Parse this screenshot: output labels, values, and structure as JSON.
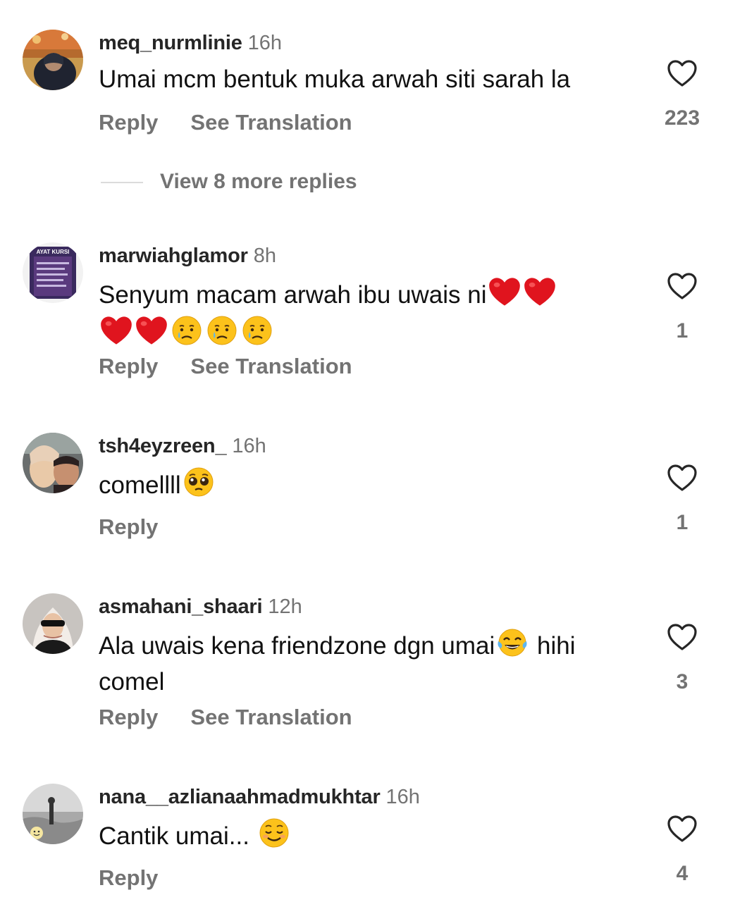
{
  "colors": {
    "text": "#111111",
    "secondary": "#737373",
    "divider": "#dbdbdb",
    "heart_red": "#e0141e"
  },
  "icons": {
    "like": "heart-outline-icon",
    "red_heart": "red-heart-emoji",
    "crying": "crying-face-emoji",
    "pleading": "pleading-face-emoji",
    "tears_of_joy": "tears-of-joy-emoji",
    "smiling": "smiling-face-emoji"
  },
  "comments": [
    {
      "username": "meq_nurmlinie",
      "time": "16h",
      "text": "Umai mcm bentuk muka arwah siti sarah la",
      "reply": "Reply",
      "translate": "See Translation",
      "likes": "223",
      "view_replies": "View 8 more replies"
    },
    {
      "username": "marwiahglamor",
      "time": "8h",
      "text": "Senyum macam arwah ibu uwais ni",
      "reply": "Reply",
      "translate": "See Translation",
      "likes": "1",
      "avatar_text": "AYAT KURSI"
    },
    {
      "username": "tsh4eyzreen_",
      "time": "16h",
      "text": "comellll",
      "reply": "Reply",
      "likes": "1"
    },
    {
      "username": "asmahani_shaari",
      "time": "12h",
      "text_before": "Ala uwais kena friendzone dgn umai",
      "text_after": " hihi comel",
      "reply": "Reply",
      "translate": "See Translation",
      "likes": "3"
    },
    {
      "username": "nana__azlianaahmadmukhtar",
      "time": "16h",
      "text": "Cantik umai... ",
      "reply": "Reply",
      "likes": "4"
    }
  ]
}
